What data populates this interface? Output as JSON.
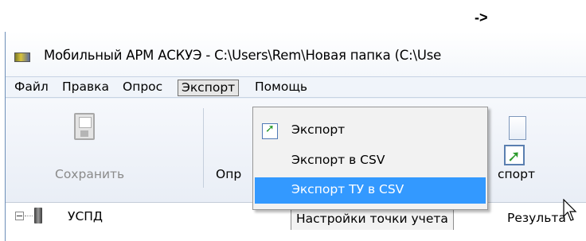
{
  "annotation": {
    "arrow": "->"
  },
  "window": {
    "title": "Мобильный АРМ АСКУЭ - C:\\Users\\Rem\\Новая папка (C:\\Use"
  },
  "menubar": {
    "items": [
      {
        "label": "Файл"
      },
      {
        "label": "Правка"
      },
      {
        "label": "Опрос"
      },
      {
        "label": "Экспорт",
        "open": true
      },
      {
        "label": "Помощь"
      }
    ]
  },
  "toolbar": {
    "save_label": "Сохранить",
    "save_enabled": false,
    "opr_label": "Опр",
    "export_label": "спорт"
  },
  "dropdown": {
    "items": [
      {
        "label": "Экспорт",
        "icon": "export-icon"
      },
      {
        "label": "Экспорт в CSV"
      },
      {
        "label": "Экспорт ТУ в CSV",
        "selected": true
      }
    ],
    "highlight_color": "#3399ff"
  },
  "tree": {
    "root_label": "УСПД",
    "root_icon": "device-icon"
  },
  "tabs": {
    "items": [
      {
        "label": "Настройки точки учета",
        "active": true
      },
      {
        "label": "Результа"
      }
    ]
  },
  "icons": [
    "app-icon",
    "save-icon",
    "export-icon",
    "mouse-cursor-icon",
    "expander-icon"
  ]
}
